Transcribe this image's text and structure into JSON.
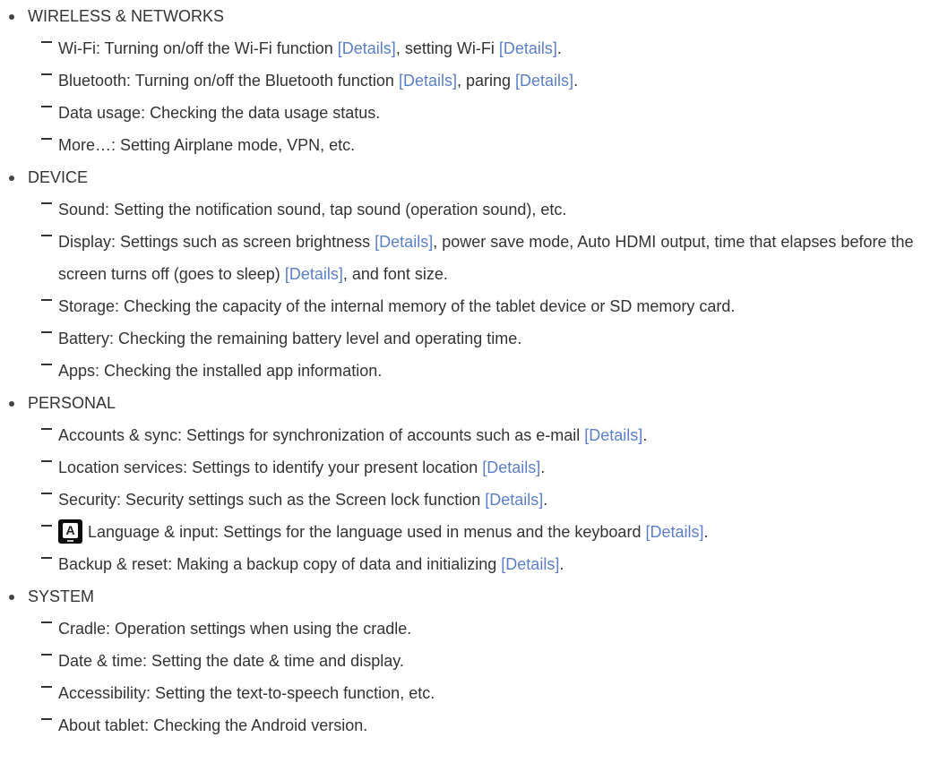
{
  "link_text": "[Details]",
  "sections": [
    {
      "title": "WIRELESS & NETWORKS",
      "items": [
        {
          "parts": [
            {
              "t": "Wi-Fi: Turning on/off the Wi-Fi function "
            },
            {
              "link": 1
            },
            {
              "t": ", setting Wi-Fi "
            },
            {
              "link": 1
            },
            {
              "t": "."
            }
          ]
        },
        {
          "parts": [
            {
              "t": "Bluetooth: Turning on/off the Bluetooth function "
            },
            {
              "link": 1
            },
            {
              "t": ", paring "
            },
            {
              "link": 1
            },
            {
              "t": "."
            }
          ]
        },
        {
          "parts": [
            {
              "t": "Data usage: Checking the data usage status."
            }
          ]
        },
        {
          "parts": [
            {
              "t": "More…: Setting Airplane mode, VPN, etc."
            }
          ]
        }
      ]
    },
    {
      "title": "DEVICE",
      "items": [
        {
          "parts": [
            {
              "t": "Sound: Setting the notification sound, tap sound (operation sound), etc."
            }
          ]
        },
        {
          "wrap": true,
          "parts": [
            {
              "t": "Display: Settings such as screen brightness "
            },
            {
              "link": 1
            },
            {
              "t": ", power save mode, Auto HDMI output, time that elapses before the screen turns off (goes to sleep) "
            },
            {
              "link": 1
            },
            {
              "t": ", and font size."
            }
          ]
        },
        {
          "wrap": true,
          "parts": [
            {
              "t": "Storage: Checking the capacity of the internal memory of the tablet device or SD memory card."
            }
          ]
        },
        {
          "parts": [
            {
              "t": "Battery: Checking the remaining battery level and operating time."
            }
          ]
        },
        {
          "parts": [
            {
              "t": "Apps: Checking the installed app information."
            }
          ]
        }
      ]
    },
    {
      "title": "PERSONAL",
      "items": [
        {
          "parts": [
            {
              "t": "Accounts & sync: Settings for synchronization of accounts such as e-mail "
            },
            {
              "link": 1
            },
            {
              "t": "."
            }
          ]
        },
        {
          "parts": [
            {
              "t": "Location services: Settings to identify your present location "
            },
            {
              "link": 1
            },
            {
              "t": "."
            }
          ]
        },
        {
          "parts": [
            {
              "t": "Security: Security settings such as the Screen lock function "
            },
            {
              "link": 1
            },
            {
              "t": "."
            }
          ]
        },
        {
          "icon": "language-input-icon",
          "parts": [
            {
              "t": "Language & input: Settings for the language used in menus and the keyboard "
            },
            {
              "link": 1
            },
            {
              "t": "."
            }
          ]
        },
        {
          "parts": [
            {
              "t": "Backup & reset: Making a backup copy of data and initializing "
            },
            {
              "link": 1
            },
            {
              "t": "."
            }
          ]
        }
      ]
    },
    {
      "title": "SYSTEM",
      "items": [
        {
          "parts": [
            {
              "t": "Cradle: Operation settings when using the cradle."
            }
          ]
        },
        {
          "parts": [
            {
              "t": "Date & time: Setting the date & time and display."
            }
          ]
        },
        {
          "parts": [
            {
              "t": "Accessibility: Setting the text-to-speech function, etc."
            }
          ]
        },
        {
          "parts": [
            {
              "t": "About tablet: Checking the Android version."
            }
          ]
        }
      ]
    }
  ],
  "icon_letter": "A",
  "colors": {
    "text": "#333333",
    "link": "#5a7fc6",
    "icon_bg": "#0d0d0d"
  }
}
